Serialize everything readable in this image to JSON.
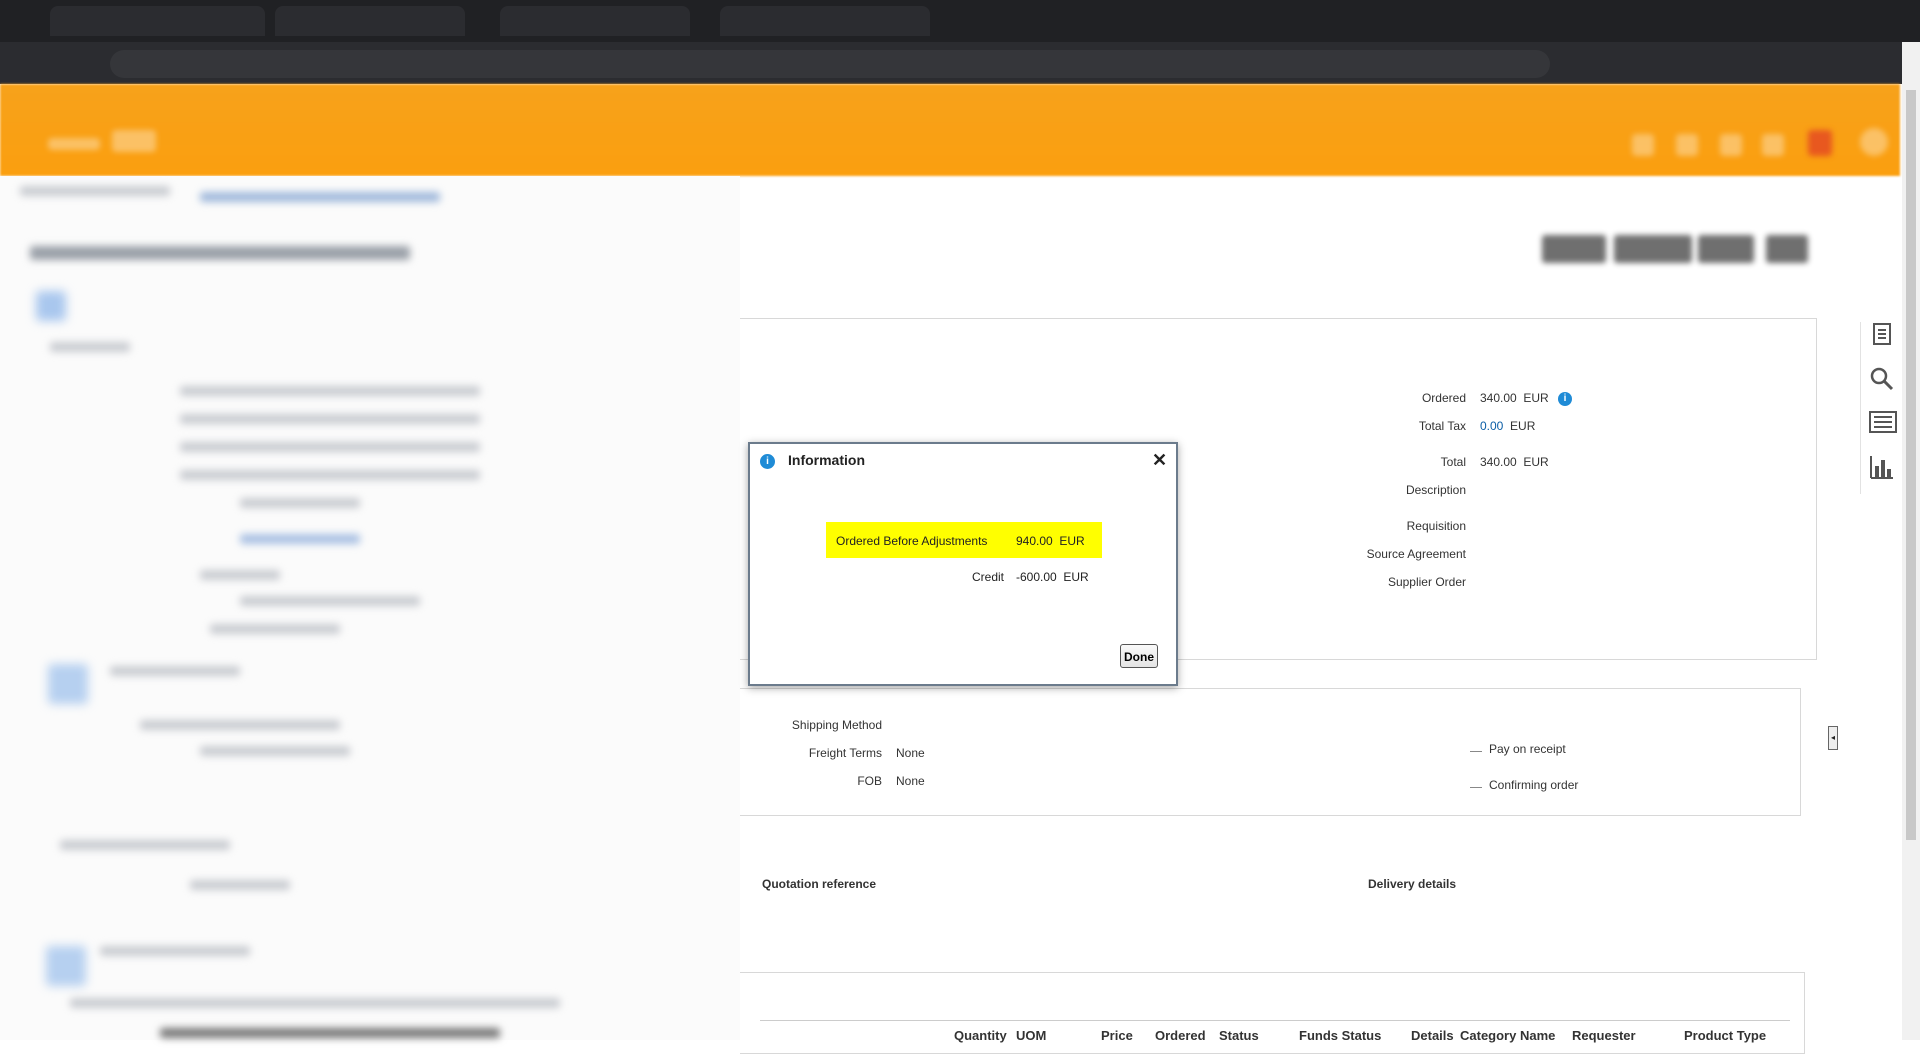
{
  "main": {
    "summary": {
      "ordered_label": "Ordered",
      "ordered_value": "340.00",
      "ordered_currency": "EUR",
      "total_tax_label": "Total Tax",
      "total_tax_value": "0.00",
      "total_tax_currency": "EUR",
      "total_label": "Total",
      "total_value": "340.00",
      "total_currency": "EUR",
      "description_label": "Description",
      "requisition_label": "Requisition",
      "source_agreement_label": "Source Agreement",
      "supplier_order_label": "Supplier Order"
    },
    "shipping": {
      "shipping_method_label": "Shipping Method",
      "freight_terms_label": "Freight Terms",
      "freight_terms_value": "None",
      "fob_label": "FOB",
      "fob_value": "None",
      "pay_on_receipt": "Pay on receipt",
      "confirming_order": "Confirming order"
    },
    "notes": {
      "quotation_reference": "Quotation reference",
      "delivery_details": "Delivery details"
    },
    "lines_table": {
      "columns": [
        "Quantity",
        "UOM",
        "Price",
        "Ordered",
        "Status",
        "Funds Status",
        "Details",
        "Category Name",
        "Requester",
        "Product Type"
      ]
    }
  },
  "dialog": {
    "title": "Information",
    "ordered_before_label": "Ordered Before Adjustments",
    "ordered_before_value": "940.00",
    "ordered_before_currency": "EUR",
    "credit_label": "Credit",
    "credit_value": "-600.00",
    "credit_currency": "EUR",
    "done_label": "Done",
    "close_glyph": "✕"
  },
  "colors": {
    "app_bar": "#fb9f0f",
    "highlight": "#ffff00",
    "info_blue": "#1f8bd6",
    "link_blue": "#0b5ea6"
  },
  "icons": {
    "side_toolbar": [
      "document-icon",
      "search-icon",
      "list-icon",
      "bar-chart-icon"
    ]
  }
}
